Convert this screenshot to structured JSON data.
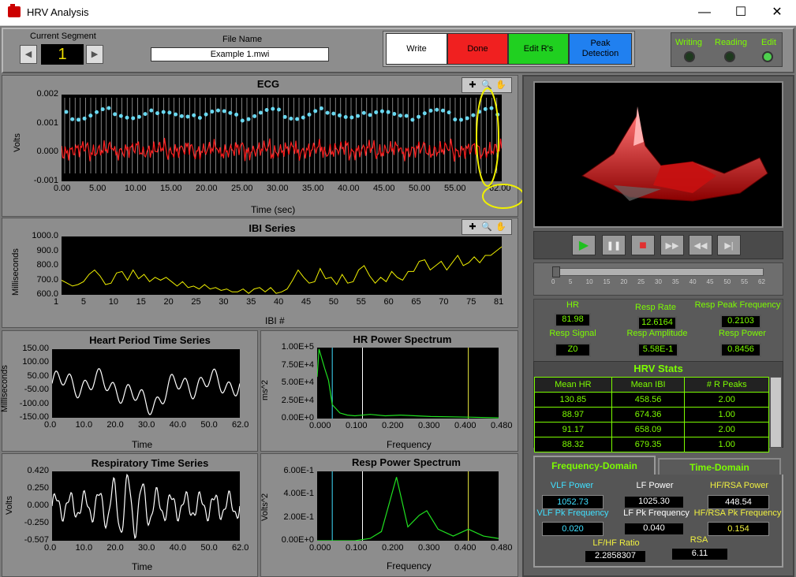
{
  "window": {
    "title": "HRV Analysis",
    "minimize": "—",
    "maximize": "☐",
    "close": "✕"
  },
  "top": {
    "segment_label": "Current Segment",
    "segment_value": "1",
    "file_label": "File Name",
    "file_value": "Example 1.mwi",
    "buttons": {
      "write": "Write",
      "done": "Done",
      "edit": "Edit R's",
      "peak": "Peak\nDetection"
    },
    "leds": {
      "writing": "Writing",
      "reading": "Reading",
      "edit": "Edit"
    },
    "colors": {
      "write": "#ffffff",
      "done": "#f02020",
      "edit": "#20d020",
      "peak": "#2080f0"
    }
  },
  "ecg": {
    "title": "ECG",
    "ylabel": "Volts",
    "xlabel": "Time (sec)",
    "yticks": [
      "0.002",
      "0.001",
      "0.000",
      "-0.001"
    ],
    "xticks": [
      "0.00",
      "5.00",
      "10.00",
      "15.00",
      "20.00",
      "25.00",
      "30.00",
      "35.00",
      "40.00",
      "45.00",
      "50.00",
      "55.00"
    ],
    "xend": "62.00"
  },
  "ibi": {
    "title": "IBI Series",
    "ylabel": "Milliseconds",
    "xlabel": "IBI #",
    "yticks": [
      "1000.0",
      "900.0",
      "800.0",
      "700.0",
      "600.0"
    ],
    "xticks": [
      "1",
      "5",
      "10",
      "15",
      "20",
      "25",
      "30",
      "35",
      "40",
      "45",
      "50",
      "55",
      "60",
      "65",
      "70",
      "75",
      "81"
    ]
  },
  "hp": {
    "title": "Heart Period Time Series",
    "ylabel": "Milliseconds",
    "xlabel": "Time",
    "yticks": [
      "150.00",
      "100.00",
      "50.00",
      "-50.00",
      "-100.00",
      "-150.00"
    ],
    "xticks": [
      "0.0",
      "10.0",
      "20.0",
      "30.0",
      "40.0",
      "50.0",
      "62.0"
    ]
  },
  "hrps": {
    "title": "HR Power Spectrum",
    "ylabel": "ms^2",
    "xlabel": "Frequency",
    "yticks": [
      "1.00E+5",
      "7.50E+4",
      "5.00E+4",
      "2.50E+4",
      "0.00E+0"
    ],
    "xticks": [
      "0.000",
      "0.100",
      "0.200",
      "0.300",
      "0.400",
      "0.480"
    ]
  },
  "resp": {
    "title": "Respiratory Time Series",
    "ylabel": "Volts",
    "xlabel": "Time",
    "yticks": [
      "0.420",
      "0.250",
      "0.000",
      "-0.250",
      "-0.507"
    ],
    "xticks": [
      "0.0",
      "10.0",
      "20.0",
      "30.0",
      "40.0",
      "50.0",
      "62.0"
    ]
  },
  "rps": {
    "title": "Resp Power Spectrum",
    "ylabel": "Volts^2",
    "xlabel": "Frequency",
    "yticks": [
      "6.00E-1",
      "4.00E-1",
      "2.00E-1",
      "0.00E+0"
    ],
    "xticks": [
      "0.000",
      "0.100",
      "0.200",
      "0.300",
      "0.400",
      "0.480"
    ]
  },
  "player": {
    "play": "▶",
    "pause": "❚❚",
    "stop": "■",
    "ff": "▶▶",
    "rew": "◀◀",
    "end": "▶|",
    "slider_ticks": [
      "0",
      "5",
      "10",
      "15",
      "20",
      "25",
      "30",
      "35",
      "40",
      "45",
      "50",
      "55",
      "62"
    ]
  },
  "stats": {
    "hr_label": "HR",
    "hr": "81.98",
    "resp_rate_label": "Resp Rate",
    "resp_rate": "12.6164",
    "resp_peak_label": "Resp Peak Frequency",
    "resp_peak": "0.2103",
    "resp_signal_label": "Resp Signal",
    "resp_signal": "Z0",
    "resp_amp_label": "Resp Amplitude",
    "resp_amp": "5.58E-1",
    "resp_power_label": "Resp Power",
    "resp_power": "0.8456"
  },
  "hrv": {
    "title": "HRV Stats",
    "headers": [
      "Mean HR",
      "Mean IBI",
      "# R Peaks"
    ],
    "rows": [
      [
        "130.85",
        "458.56",
        "2.00"
      ],
      [
        "88.97",
        "674.36",
        "1.00"
      ],
      [
        "91.17",
        "658.09",
        "2.00"
      ],
      [
        "88.32",
        "679.35",
        "1.00"
      ]
    ]
  },
  "freq": {
    "tab_freq": "Frequency-Domain",
    "tab_time": "Time-Domain",
    "vlf_power_label": "VLF  Power",
    "vlf_power": "1052.73",
    "lf_power_label": "LF Power",
    "lf_power": "1025.30",
    "hf_power_label": "HF/RSA Power",
    "hf_power": "448.54",
    "vlf_pk_label": "VLF Pk Frequency",
    "vlf_pk": "0.020",
    "lf_pk_label": "LF Pk Frequency",
    "lf_pk": "0.040",
    "hf_pk_label": "HF/RSA Pk Frequency",
    "hf_pk": "0.154",
    "lfhf_label": "LF/HF Ratio",
    "lfhf": "2.2858307",
    "rsa_label": "RSA",
    "rsa": "6.11",
    "colors": {
      "vlf": "#40e0ff",
      "lf": "#ffffff",
      "hf": "#f0f040"
    }
  }
}
